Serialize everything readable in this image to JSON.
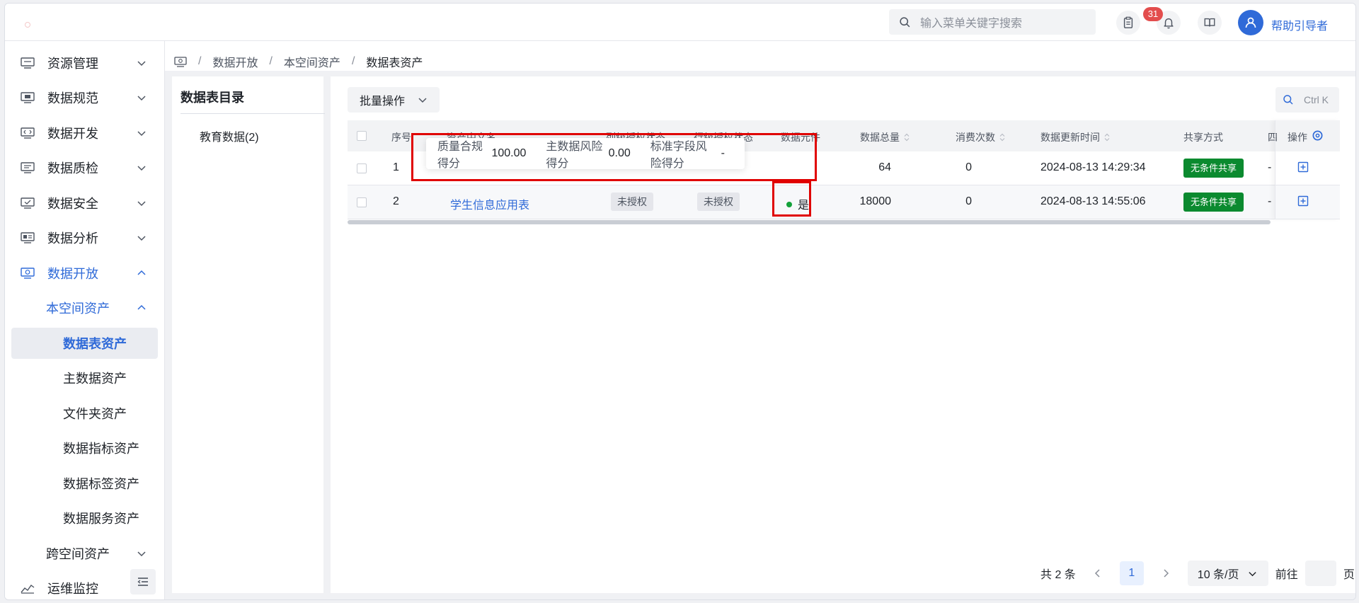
{
  "topbar": {
    "search_placeholder": "输入菜单关键字搜索",
    "notification_count": "31",
    "username": "帮助引导者"
  },
  "sidebar": {
    "items": [
      {
        "label": "资源管理",
        "icon": "resource-icon"
      },
      {
        "label": "数据规范",
        "icon": "standard-icon"
      },
      {
        "label": "数据开发",
        "icon": "develop-icon"
      },
      {
        "label": "数据质检",
        "icon": "quality-icon"
      },
      {
        "label": "数据安全",
        "icon": "security-icon"
      },
      {
        "label": "数据分析",
        "icon": "analysis-icon"
      },
      {
        "label": "数据开放",
        "icon": "open-icon"
      }
    ],
    "sub": {
      "label": "本空间资产"
    },
    "leaves": [
      {
        "label": "数据表资产"
      },
      {
        "label": "主数据资产"
      },
      {
        "label": "文件夹资产"
      },
      {
        "label": "数据指标资产"
      },
      {
        "label": "数据标签资产"
      },
      {
        "label": "数据服务资产"
      }
    ],
    "sub2": {
      "label": "跨空间资产"
    },
    "ops": {
      "label": "运维监控"
    }
  },
  "breadcrumb": [
    "数据开放",
    "本空间资产",
    "数据表资产"
  ],
  "catalog": {
    "title": "数据表目录",
    "items": [
      "教育数据(2)"
    ]
  },
  "toolbar": {
    "batch_label": "批量操作",
    "search_hint": "Ctrl K"
  },
  "table": {
    "headers": {
      "index": "序号",
      "name": "资产中文名",
      "col_auth": "列级授权状态",
      "row_auth": "行级授权状态",
      "meta": "数据元件",
      "total": "数据总量",
      "consume": "消费次数",
      "updated": "数据更新时间",
      "share": "共享方式",
      "extra": "四",
      "op": "操作"
    },
    "rows": [
      {
        "index": "1",
        "name": "",
        "col_auth": "",
        "row_auth": "",
        "meta": "",
        "total": "64",
        "consume": "0",
        "updated": "2024-08-13 14:29:34",
        "share": "无条件共享",
        "extra": "-"
      },
      {
        "index": "2",
        "name": "学生信息应用表",
        "col_auth": "未授权",
        "row_auth": "未授权",
        "meta": "是",
        "total": "18000",
        "consume": "0",
        "updated": "2024-08-13 14:55:06",
        "share": "无条件共享",
        "extra": "-"
      }
    ]
  },
  "tooltip": {
    "quality_label": "质量合规得分",
    "quality_value": "100.00",
    "master_label": "主数据风险得分",
    "master_value": "0.00",
    "field_label": "标准字段风险得分",
    "field_value": "-"
  },
  "pagination": {
    "total": "共 2 条",
    "page": "1",
    "page_size": "10 条/页",
    "goto": "前往",
    "page_unit": "页"
  },
  "colors": {
    "accent": "#2f6ad8",
    "share_tag": "#0b8a2f",
    "highlight": "#e00000",
    "badge": "#e34d4d"
  }
}
